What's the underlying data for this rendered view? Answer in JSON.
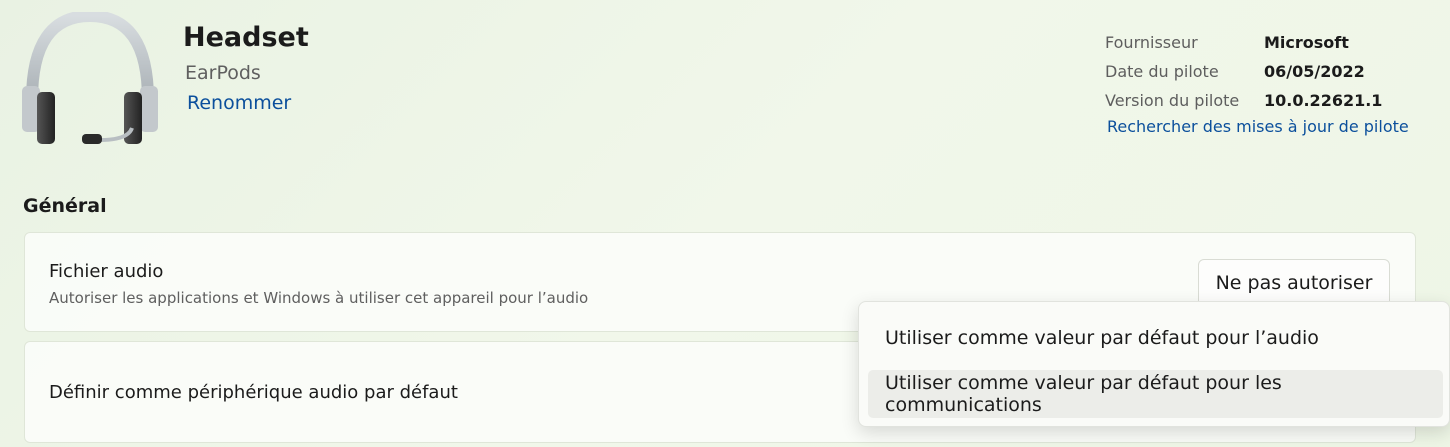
{
  "device": {
    "name": "Headset",
    "model": "EarPods",
    "rename_link": "Renommer"
  },
  "driver_info": {
    "rows": [
      {
        "label": "Fournisseur",
        "value": "Microsoft"
      },
      {
        "label": "Date du pilote",
        "value": "06/05/2022"
      },
      {
        "label": "Version du pilote",
        "value": "10.0.22621.1"
      }
    ],
    "update_link": "Rechercher des mises à jour de pilote"
  },
  "general": {
    "title": "Général",
    "audio_card": {
      "title": "Fichier audio",
      "description": "Autoriser les applications et Windows à utiliser cet appareil pour l’audio",
      "button": "Ne pas autoriser"
    },
    "default_card": {
      "title": "Définir comme périphérique audio par défaut"
    }
  },
  "dropdown": {
    "items": [
      "Utiliser comme valeur par défaut pour l’audio",
      "Utiliser comme valeur par défaut pour les communications"
    ]
  },
  "colors": {
    "link": "#0b4f9c",
    "accent_background": "#eef6e6"
  }
}
